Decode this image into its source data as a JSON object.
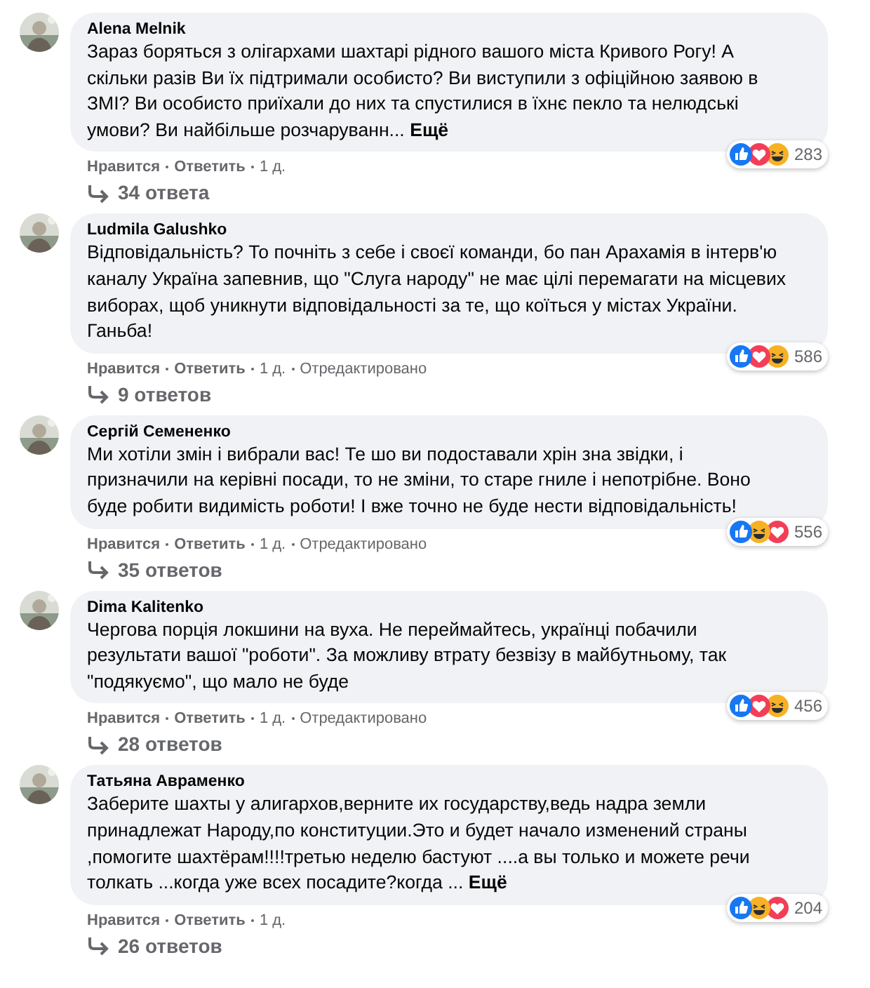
{
  "comments": [
    {
      "author": "Alena Melnik",
      "text": "Зараз боряться з олігархами шахтарі рідного вашого міста Кривого Рогу! А\nскільки разів Ви їх підтримали особисто? Ви виступили з офіційною заявою в\nЗМІ? Ви особисто приїхали до них та спустилися в їхнє пекло та нелюдські\nумови? Ви найбільше розчаруванн... **Ещё**",
      "reactions": [
        {
          "kind": "like"
        },
        {
          "kind": "love"
        },
        {
          "kind": "haha"
        }
      ],
      "reaction_count": "283",
      "actions": [
        "Нравится",
        "Ответить"
      ],
      "time": "1 д.",
      "replies": "34 ответа"
    },
    {
      "author": "Ludmila Galushko",
      "text": "Відповідальність? То почніть з себе і своєї команди, бо пан Арахамія в інтерв'ю\nканалу Україна запевнив, що \"Слуга народу\" не має цілі перемагати на місцевих\nвиборах, щоб уникнути відповідальності за те, що коїться у містах України.\nГаньба!",
      "reactions": [
        {
          "kind": "like"
        },
        {
          "kind": "love"
        },
        {
          "kind": "haha"
        }
      ],
      "reaction_count": "586",
      "actions": [
        "Нравится",
        "Ответить"
      ],
      "time": "1 д.",
      "edited": "Отредактировано",
      "replies": "9 ответов"
    },
    {
      "author": "Сергій Семененко",
      "text": "Ми хотіли змін і вибрали вас! Те шо ви подоставали хрін зна звідки, і\nпризначили на керівні посади, то не зміни, то старе гниле і непотрібне. Воно\nбуде робити видимість роботи! І вже точно не буде нести відповідальність!",
      "reactions": [
        {
          "kind": "like"
        },
        {
          "kind": "haha"
        },
        {
          "kind": "love"
        }
      ],
      "reaction_count": "556",
      "actions": [
        "Нравится",
        "Ответить"
      ],
      "time": "1 д.",
      "edited": "Отредактировано",
      "replies": "35 ответов"
    },
    {
      "author": "Dima Kalitenko",
      "text": "Чергова порція локшини на вуха. Не переймайтесь, українці побачили\nрезультати вашої \"роботи\". За можливу втрату безвізу в майбутньому, так\n\"подякуємо\", що мало не буде",
      "reactions": [
        {
          "kind": "like"
        },
        {
          "kind": "love"
        },
        {
          "kind": "haha"
        }
      ],
      "reaction_count": "456",
      "actions": [
        "Нравится",
        "Ответить"
      ],
      "time": "1 д.",
      "edited": "Отредактировано",
      "replies": "28 ответов"
    },
    {
      "author": "Татьяна Авраменко",
      "text": "Заберите шахты у алигархов,верните их государству,ведь надра земли\nпринадлежат Народу,по конституции.Это и будет начало изменений страны\n,помогите шахтёрам!!!!третью неделю бастуют ....а вы только и можете речи\nтолкать ...когда уже всех посадите?когда ... **Ещё**",
      "reactions": [
        {
          "kind": "like"
        },
        {
          "kind": "haha"
        },
        {
          "kind": "love"
        }
      ],
      "reaction_count": "204",
      "actions": [
        "Нравится",
        "Ответить"
      ],
      "time": "1 д.",
      "replies": "26 ответов"
    }
  ]
}
